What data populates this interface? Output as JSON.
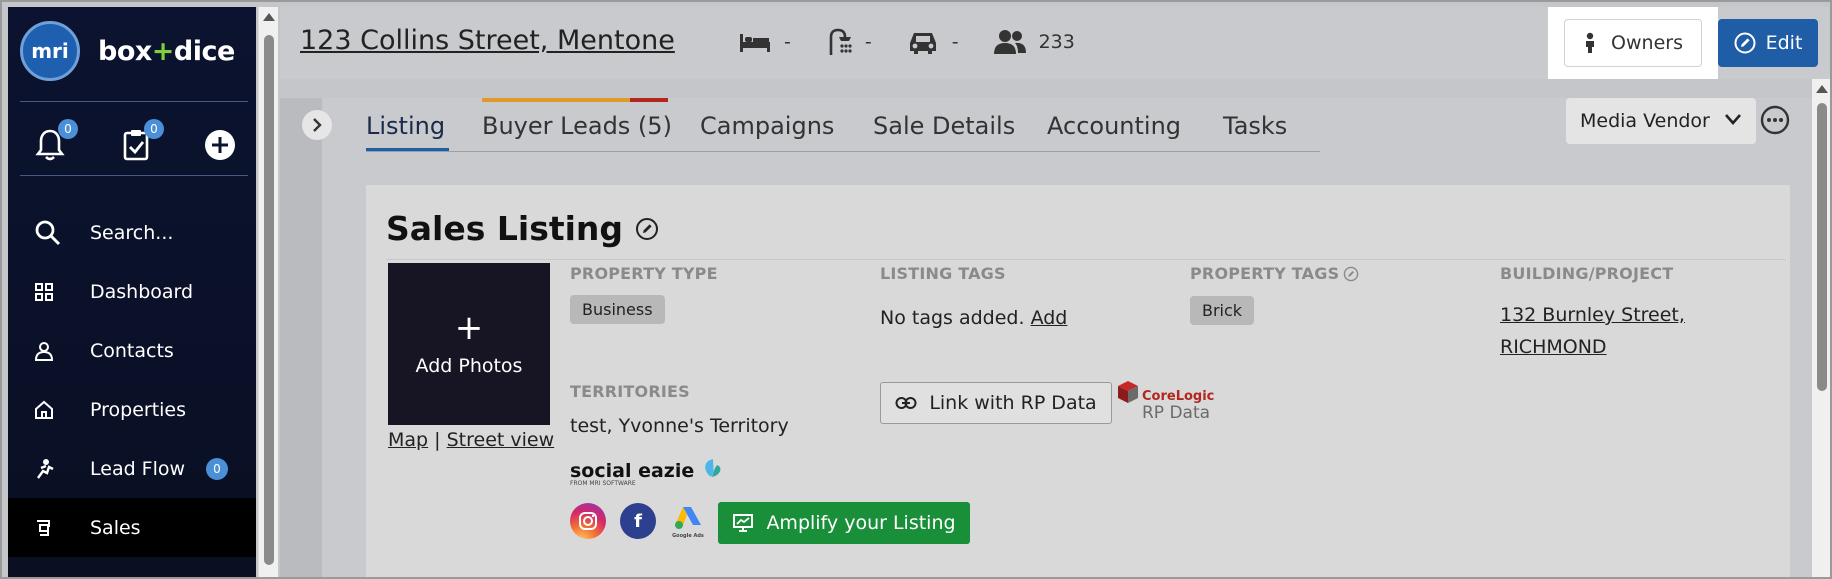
{
  "brand": {
    "logo_text": "mri",
    "name_part1": "box",
    "name_plus": "+",
    "name_part2": "dice"
  },
  "quick": {
    "notifications_count": "0",
    "tasks_count": "0"
  },
  "nav": {
    "search": "Search...",
    "dashboard": "Dashboard",
    "contacts": "Contacts",
    "properties": "Properties",
    "lead_flow": "Lead Flow",
    "lead_flow_count": "0",
    "sales": "Sales"
  },
  "header": {
    "address": "123 Collins Street, Mentone",
    "beds": "-",
    "baths": "-",
    "cars": "-",
    "people": "233",
    "owners_label": "Owners",
    "edit_label": "Edit"
  },
  "tabs": [
    {
      "label": "Listing"
    },
    {
      "label": "Buyer Leads (5)"
    },
    {
      "label": "Campaigns"
    },
    {
      "label": "Sale Details"
    },
    {
      "label": "Accounting"
    },
    {
      "label": "Tasks"
    }
  ],
  "media_select": {
    "value": "Media Vendor"
  },
  "card": {
    "title": "Sales Listing",
    "add_photos": "Add Photos",
    "add_photos_plus": "+",
    "map_link": "Map",
    "map_sep": "|",
    "street_view_link": "Street view",
    "property_type_label": "PROPERTY TYPE",
    "property_type_value": "Business",
    "listing_tags_label": "LISTING TAGS",
    "listing_tags_empty": "No tags added.",
    "listing_tags_add": "Add",
    "property_tags_label": "PROPERTY TAGS",
    "property_tags_value": "Brick",
    "building_label": "BUILDING/PROJECT",
    "building_line1": "132 Burnley Street,",
    "building_line2": "RICHMOND",
    "territories_label": "TERRITORIES",
    "territories_value": "test, Yvonne's Territory",
    "rp_button": "Link with RP Data",
    "corelogic_line1": "CoreLogic",
    "corelogic_line2": "RP Data",
    "social_eazie": "social eazie",
    "social_eazie_sub": "FROM MRI SOFTWARE",
    "google_ads_label": "Google Ads",
    "amplify_button": "Amplify your Listing"
  },
  "colors": {
    "sidebar_bg": "#0b1330",
    "brand_blue": "#1f5da6",
    "amplify_green": "#1a8f3a",
    "tab_orange": "#e09a2a",
    "tab_red": "#b3261e"
  },
  "icons": [
    "bell-icon",
    "clipboard-check-icon",
    "plus-circle-icon",
    "search-icon",
    "dashboard-icon",
    "contact-icon",
    "home-icon",
    "lead-flow-icon",
    "sales-icon",
    "bed-icon",
    "shower-icon",
    "car-icon",
    "people-icon",
    "person-icon",
    "edit-icon",
    "chevron-right-icon",
    "chevron-down-icon",
    "more-icon",
    "link-icon",
    "instagram-icon",
    "facebook-icon",
    "google-ads-icon",
    "presentation-icon"
  ]
}
